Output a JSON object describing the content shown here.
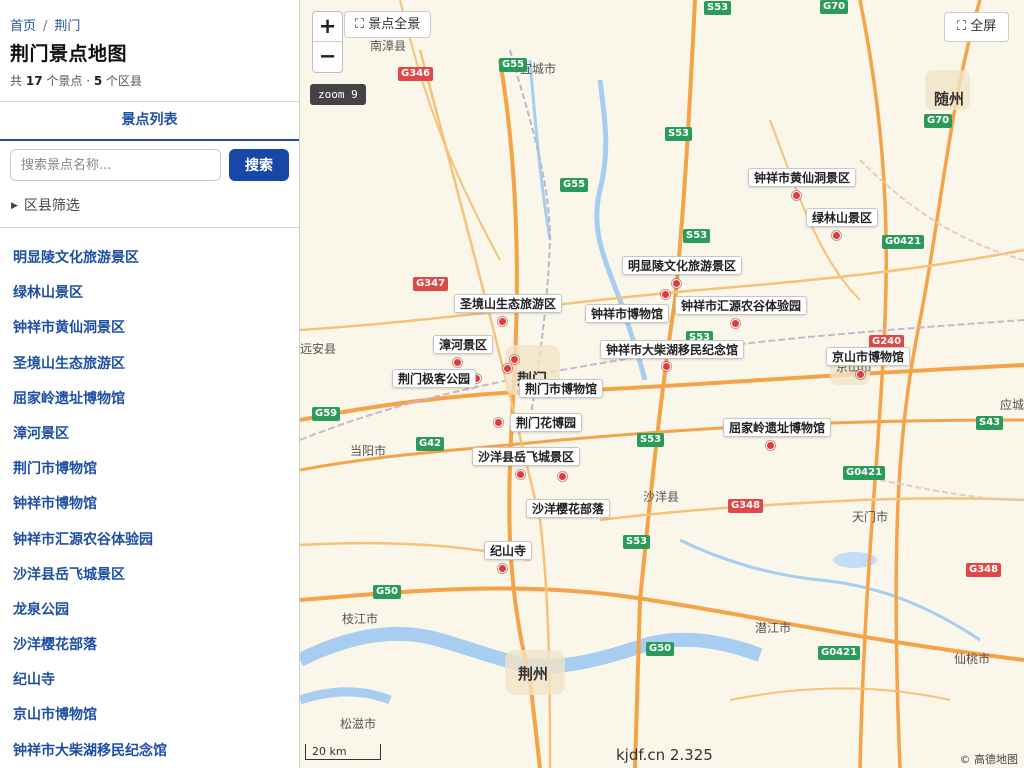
{
  "breadcrumb": {
    "home": "首页",
    "separator": "/",
    "current": "荆门"
  },
  "page_title": "荆门景点地图",
  "summary": {
    "prefix": "共",
    "spots_count": "17",
    "spots_unit": "个景点 ·",
    "districts_count": "5",
    "districts_unit": "个区县"
  },
  "tab": {
    "label": "景点列表"
  },
  "search": {
    "placeholder": "搜索景点名称...",
    "value": "",
    "button_label": "搜索"
  },
  "filter": {
    "label": "区县筛选"
  },
  "spot_list": [
    "明显陵文化旅游景区",
    "绿林山景区",
    "钟祥市黄仙洞景区",
    "圣境山生态旅游区",
    "屈家岭遗址博物馆",
    "漳河景区",
    "荆门市博物馆",
    "钟祥市博物馆",
    "钟祥市汇源农谷体验园",
    "沙洋县岳飞城景区",
    "龙泉公园",
    "沙洋樱花部落",
    "纪山寺",
    "京山市博物馆",
    "钟祥市大柴湖移民纪念馆"
  ],
  "map": {
    "zoom_in": "+",
    "zoom_out": "−",
    "overview_button": "景点全景",
    "fullscreen_button": "全屏",
    "zoom_label": "zoom 9",
    "scale_label": "20 km",
    "watermark": "kjdf.cn 2.325",
    "credit": "© 高德地图",
    "expand_icon": "⛶",
    "markers": [
      "钟祥市黄仙洞景区",
      "绿林山景区",
      "明显陵文化旅游景区",
      "圣境山生态旅游区",
      "钟祥市博物馆",
      "钟祥市汇源农谷体验园",
      "漳河景区",
      "钟祥市大柴湖移民纪念馆",
      "京山市博物馆",
      "荆门极客公园",
      "荆门市博物馆",
      "荆门花博园",
      "屈家岭遗址博物馆",
      "沙洋县岳飞城景区",
      "沙洋樱花部落",
      "纪山寺"
    ],
    "city_labels": [
      "南漳县",
      "宜城市",
      "随州",
      "远安县",
      "荆门",
      "京山市",
      "当阳市",
      "沙洋县",
      "天门市",
      "应城",
      "枝江市",
      "潜江市",
      "荆州",
      "仙桃市",
      "松滋市"
    ],
    "highway_shields": [
      "G55",
      "G346",
      "S53",
      "G70",
      "G70",
      "S53",
      "G55",
      "S53",
      "G0421",
      "G347",
      "S53",
      "G240",
      "G59",
      "G42",
      "S53",
      "G0421",
      "S43",
      "G348",
      "S53",
      "G348",
      "G50",
      "G50",
      "G0421"
    ]
  },
  "colors": {
    "accent": "#1748a8",
    "link": "#1e4fa3",
    "marker": "#e23a3a",
    "map_land": "#fbf6ea",
    "highway": "#f5a348",
    "water": "#a7cdf0"
  }
}
